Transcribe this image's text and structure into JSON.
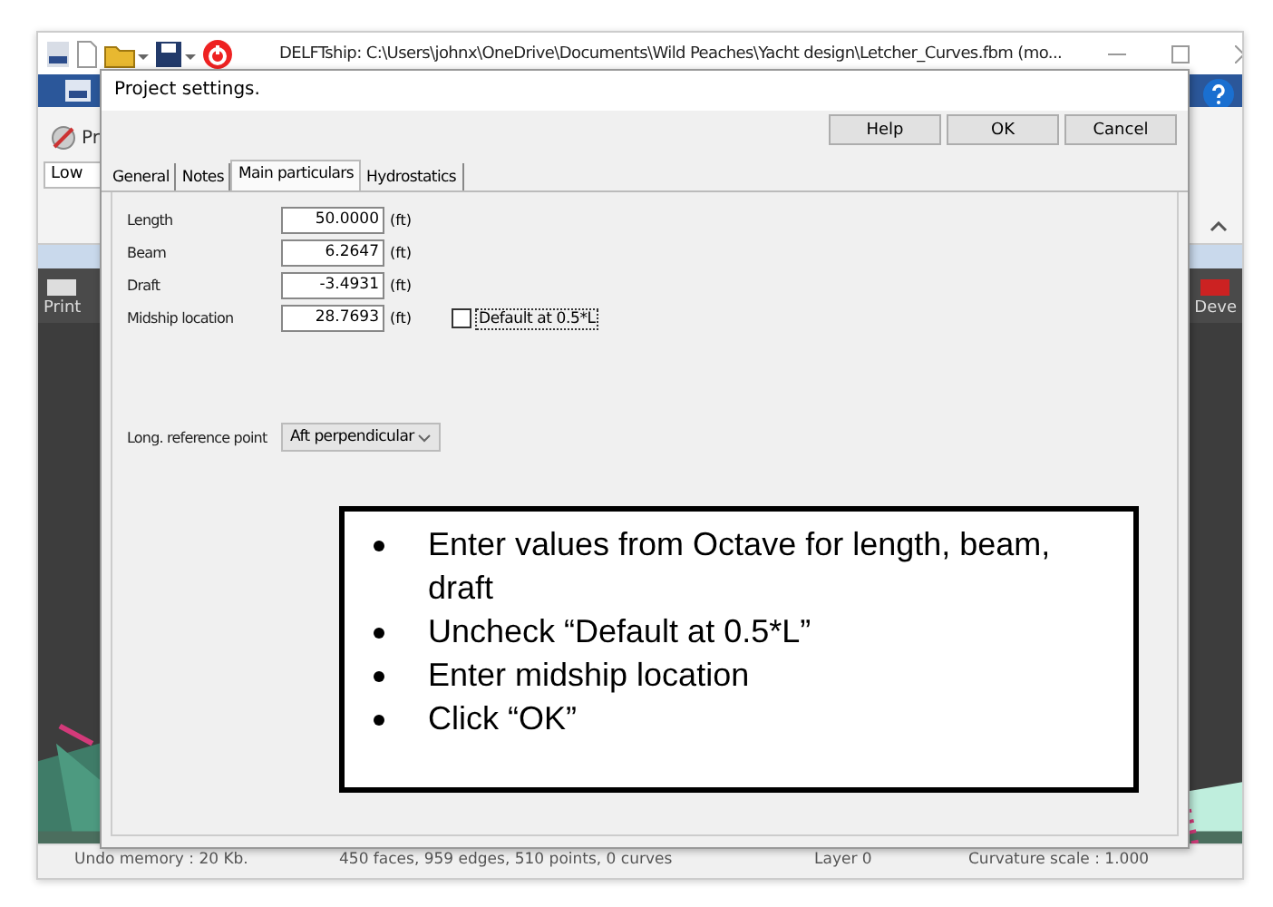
{
  "app": {
    "title": "DELFTship: C:\\Users\\johnx\\OneDrive\\Documents\\Wild Peaches\\Yacht design\\Letcher_Curves.fbm (mo...",
    "ribbon_label": "Pr",
    "quality": "Low",
    "toolbar_items": [
      {
        "label": "Print"
      },
      {
        "label": "Deve"
      }
    ]
  },
  "dialog": {
    "title": "Project settings.",
    "buttons": [
      "Help",
      "OK",
      "Cancel"
    ],
    "tabs": [
      {
        "label": "General",
        "selected": false
      },
      {
        "label": "Notes",
        "selected": false
      },
      {
        "label": "Main particulars",
        "selected": true
      },
      {
        "label": "Hydrostatics",
        "selected": false
      }
    ],
    "fields": [
      {
        "label": "Length",
        "value": "50.0000",
        "unit": "(ft)"
      },
      {
        "label": "Beam",
        "value": "6.2647",
        "unit": "(ft)"
      },
      {
        "label": "Draft",
        "value": "-3.4931",
        "unit": "(ft)"
      },
      {
        "label": "Midship location",
        "value": "28.7693",
        "unit": "(ft)",
        "option": {
          "label": "Default at 0.5*L",
          "checked": false
        }
      }
    ],
    "reference_point": {
      "label": "Long. reference point",
      "value": "Aft perpendicular"
    }
  },
  "callout": {
    "items": [
      "Enter values from Octave for length, beam, draft",
      "Uncheck “Default at 0.5*L”",
      "Enter midship location",
      "Click “OK”"
    ]
  },
  "status_bar": [
    "Undo memory : 20 Kb.",
    "450 faces, 959 edges, 510 points, 0 curves",
    "Layer 0",
    "Curvature scale : 1.000"
  ]
}
